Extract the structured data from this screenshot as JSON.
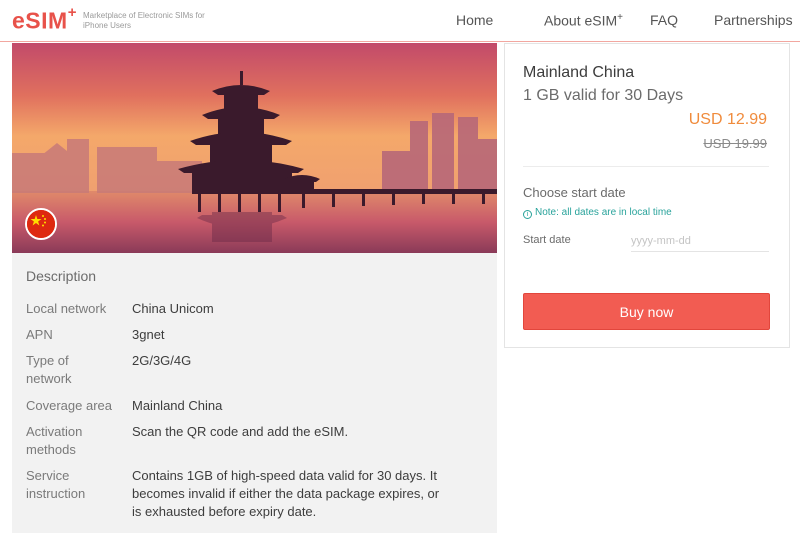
{
  "brand": {
    "name": "eSIM",
    "plus": "+",
    "tagline": "Marketplace of Electronic SIMs for iPhone Users"
  },
  "nav": {
    "home": "Home",
    "about": "About eSIM",
    "about_plus": "+",
    "faq": "FAQ",
    "partnerships": "Partnerships"
  },
  "hero": {
    "image_icon": "pagoda-lake-sunset-image",
    "flag_icon": "china-flag-icon"
  },
  "description": {
    "title": "Description",
    "rows": [
      {
        "label": "Local network",
        "value": "China Unicom"
      },
      {
        "label": "APN",
        "value": "3gnet"
      },
      {
        "label": "Type of network",
        "value": "2G/3G/4G"
      },
      {
        "label": "Coverage area",
        "value": "Mainland China"
      },
      {
        "label": "Activation methods",
        "value": "Scan the QR code and add the eSIM."
      },
      {
        "label": "Service instruction",
        "value": "Contains 1GB of high-speed data valid for 30 days. It becomes invalid if either the data package expires, or is exhausted before expiry date."
      }
    ]
  },
  "purchase": {
    "title": "Mainland China",
    "plan": "1 GB valid for 30 Days",
    "price": "USD 12.99",
    "old_price": "USD 19.99",
    "choose_label": "Choose start date",
    "note": "Note: all dates are in local time",
    "start_date_label": "Start date",
    "start_date_placeholder": "yyyy-mm-dd",
    "start_date_value": "",
    "buy_label": "Buy now"
  },
  "colors": {
    "brand": "#e8524a",
    "price": "#f08b3c",
    "note": "#29a39b",
    "button": "#f25c52"
  }
}
